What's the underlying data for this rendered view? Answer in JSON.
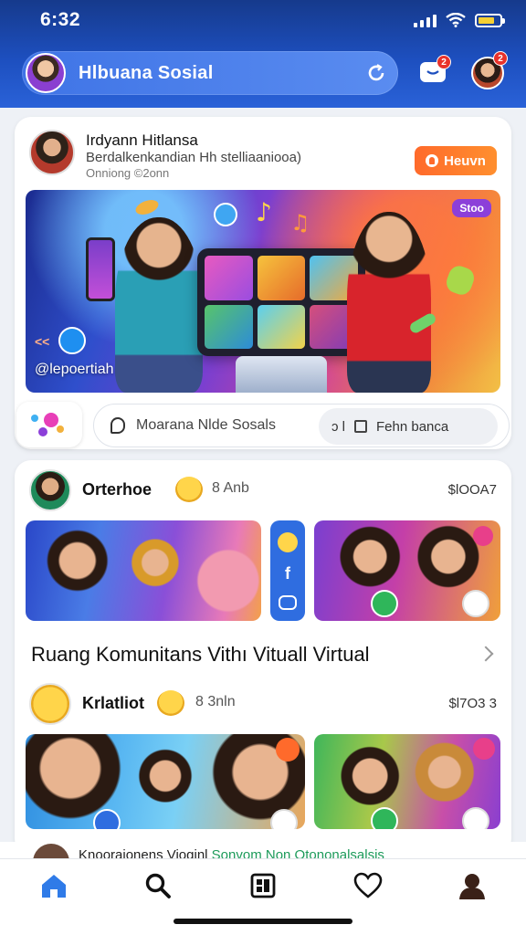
{
  "status_bar": {
    "time": "6:32"
  },
  "header": {
    "app_title": "Hlbuana Sosial",
    "message_badge": "2",
    "profile_badge": "2"
  },
  "featured_post": {
    "author_name": "Irdyann Hitlansa",
    "author_subtitle": "Berdalkenkandian Hh stelliaaniooa)",
    "author_time": "Onniong ©2onn",
    "follow_label": "Heuvn",
    "hero_tag": "Stoo",
    "hero_handle": "@lepoertiah",
    "search_placeholder": "Moarana Nlde Sosals",
    "filter_prefix": "ↄ l",
    "filter_label": "Fehn banca"
  },
  "community": {
    "row1": {
      "name": "Orterhoe",
      "meta": "8 Anb",
      "count": "$lOOA7"
    },
    "section_title": "Ruang Komunitans Vithı Vituall Virtual",
    "row2": {
      "name": "Krlatliot",
      "meta": "8 3nln",
      "count": "$l7O3 3"
    },
    "peek_text": "Knooraionens Vioginl",
    "peek_accent": "Sonvom Non Otononalsalsis"
  },
  "colors": {
    "brand_blue": "#1d4fbf",
    "accent_orange": "#ff6a2b",
    "badge_red": "#e8322b"
  },
  "icons": {
    "nav": [
      "home-icon",
      "search-icon",
      "feed-icon",
      "heart-icon",
      "profile-icon"
    ]
  }
}
